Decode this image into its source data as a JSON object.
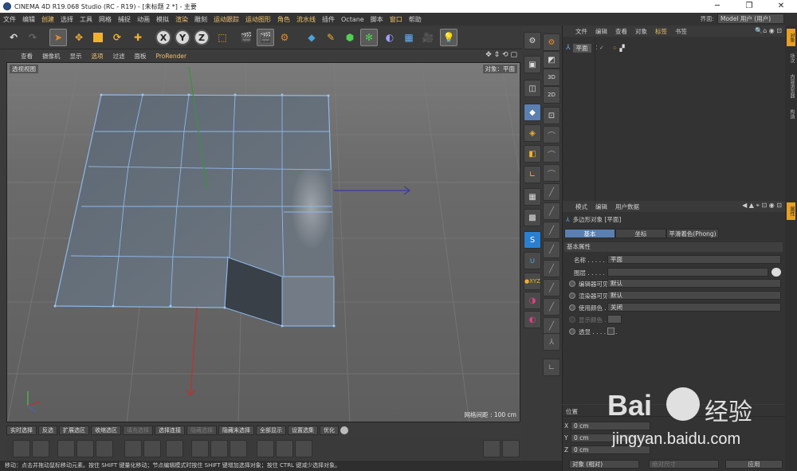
{
  "titlebar": {
    "title": "CINEMA 4D R19.068 Studio (RC - R19) - [未标题 2 *] - 主要",
    "min": "─",
    "max": "❐",
    "close": "✕"
  },
  "menubar": {
    "items": [
      "文件",
      "编辑",
      "创建",
      "选择",
      "工具",
      "网格",
      "捕捉",
      "动画",
      "模拟",
      "渲染",
      "雕刻",
      "运动跟踪",
      "运动图形",
      "角色",
      "流水线",
      "插件",
      "Octane",
      "脚本",
      "窗口",
      "帮助"
    ],
    "layout_label": "界面:",
    "layout_value": "Model 用户 (用户)"
  },
  "toolbar": {
    "x": "X",
    "y": "Y",
    "z": "Z"
  },
  "viewport": {
    "menu": [
      "查看",
      "摄像机",
      "显示",
      "选项",
      "过滤",
      "面板",
      "ProRender"
    ],
    "label": "透视视图",
    "object_label": "对象：平面",
    "grid_spacing": "网格间距 : 100 cm"
  },
  "objman": {
    "menu": [
      "文件",
      "编辑",
      "查看",
      "对象",
      "标签",
      "书签"
    ],
    "object_name": "平面"
  },
  "attrman": {
    "menu": [
      "模式",
      "编辑",
      "用户数据"
    ],
    "title": "多边形对象 [平面]",
    "tabs": [
      "基本",
      "坐标",
      "平滑着色(Phong)"
    ],
    "section": "基本属性",
    "rows": {
      "name_label": "名称 . . . . . . .",
      "name_value": "平面",
      "layer_label": "图层 . . . . . . .",
      "editor_vis_label": "编辑器可见",
      "editor_vis_value": "默认",
      "render_vis_label": "渲染器可见",
      "render_vis_value": "默认",
      "use_color_label": "使用颜色 . . .",
      "use_color_value": "关闭",
      "display_color_label": "显示颜色 . . .",
      "xray_label": "透显 . . . . . . ."
    }
  },
  "coordman": {
    "title": "位置",
    "x_label": "X",
    "x_value": "0 cm",
    "y_label": "Y",
    "y_value": "0 cm",
    "z_label": "Z",
    "z_value": "0 cm",
    "mode": "对象 (相对)",
    "size_mode": "绝对尺寸",
    "apply": "应用"
  },
  "btnbar": [
    "实时选择",
    "反选",
    "扩展选区",
    "收缩选区",
    "填充选择",
    "选择连接",
    "隐藏选择",
    "隐藏未选择",
    "全部显示",
    "设置选集",
    "优化"
  ],
  "statusbar": "移动：点击并拖动鼠标移动元素。按住 SHIFT 键量化移动；节点编辑模式时按住 SHIFT 键增加选择对象；按住 CTRL 键减少选择对象。",
  "sidetabs": [
    "对象",
    "场次",
    "内容浏览器",
    "构造"
  ],
  "attr_sidetab": "属性",
  "watermark": {
    "brand": "Bai",
    "brand2": "经验",
    "url": "jingyan.baidu.com"
  }
}
